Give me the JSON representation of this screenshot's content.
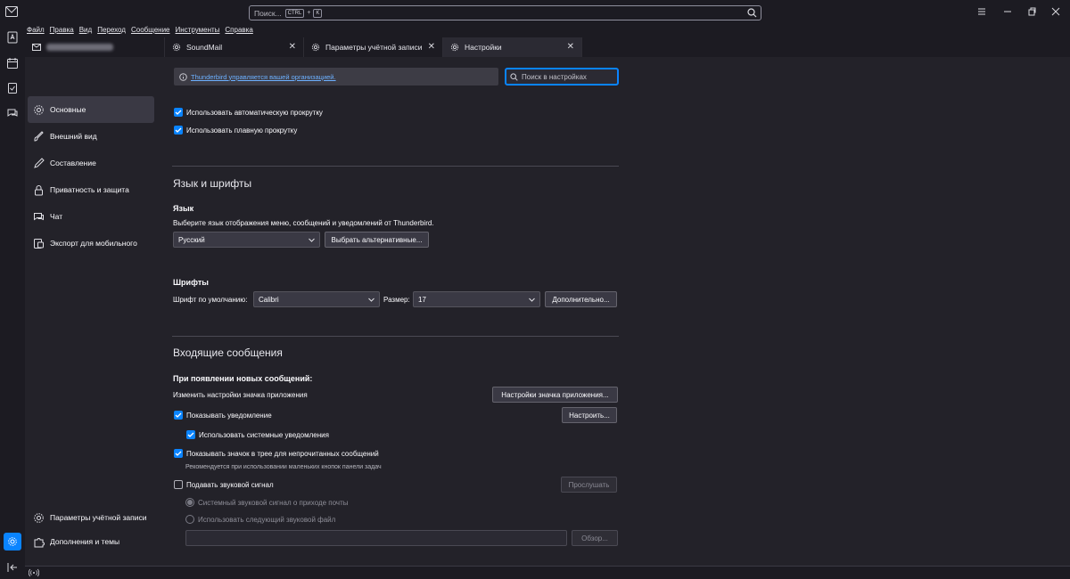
{
  "search": {
    "placeholder": "Поиск...",
    "kbd_ctrl": "CTRL",
    "plus": "+",
    "kbd_k": "K"
  },
  "menu": [
    "Файл",
    "Правка",
    "Вид",
    "Переход",
    "Сообщение",
    "Инструменты",
    "Справка"
  ],
  "tabs": [
    {
      "label": "",
      "icon": "mail-account-icon",
      "closable": false
    },
    {
      "label": "SoundMail",
      "icon": "settings-icon",
      "closable": true
    },
    {
      "label": "Параметры учётной записи",
      "icon": "settings-icon",
      "closable": true
    },
    {
      "label": "Настройки",
      "icon": "settings-icon",
      "closable": true,
      "active": true
    }
  ],
  "nav": {
    "items": [
      {
        "label": "Основные",
        "icon": "gear-icon",
        "active": true
      },
      {
        "label": "Внешний вид",
        "icon": "brush-icon"
      },
      {
        "label": "Составление",
        "icon": "pencil-icon"
      },
      {
        "label": "Приватность и защита",
        "icon": "lock-icon"
      },
      {
        "label": "Чат",
        "icon": "chat-icon"
      },
      {
        "label": "Экспорт для мобильного",
        "icon": "mobile-icon"
      }
    ],
    "bottom": [
      {
        "label": "Параметры учётной записи",
        "icon": "gear-icon"
      },
      {
        "label": "Дополнения и темы",
        "icon": "puzzle-icon"
      }
    ]
  },
  "policy_notice": "Thunderbird управляется вашей организацией.",
  "find": {
    "placeholder": "Поиск в настройках"
  },
  "scroll": {
    "auto_scroll": "Использовать автоматическую прокрутку",
    "smooth_scroll": "Использовать плавную прокрутку"
  },
  "lang_fonts": {
    "title": "Язык и шрифты",
    "language_heading": "Язык",
    "language_desc": "Выберите язык отображения меню, сообщений и уведомлений от Thunderbird.",
    "language_value": "Русский",
    "choose_alt": "Выбрать альтернативные...",
    "fonts_heading": "Шрифты",
    "default_font_label": "Шрифт по умолчанию:",
    "default_font_value": "Calibri",
    "size_label": "Размер:",
    "size_value": "17",
    "advanced": "Дополнительно..."
  },
  "incoming": {
    "title": "Входящие сообщения",
    "when_new": "При появлении новых сообщений:",
    "app_icon_settings_label": "Изменить настройки значка приложения",
    "app_icon_settings_button": "Настройки значка приложения...",
    "show_notification": "Показывать уведомление",
    "configure": "Настроить...",
    "system_notifications": "Использовать системные уведомления",
    "tray_icon": "Показывать значок в трее для непрочитанных сообщений",
    "tray_hint": "Рекомендуется при использовании маленьких кнопок панели задач",
    "play_sound": "Подавать звуковой сигнал",
    "preview": "Прослушать",
    "system_sound": "Системный звуковой сигнал о приходе почты",
    "custom_sound": "Использовать следующий звуковой файл",
    "browse": "Обзор..."
  },
  "colors": {
    "accent": "#0a84ff",
    "bg": "#1c1b22",
    "panel": "#232229"
  }
}
